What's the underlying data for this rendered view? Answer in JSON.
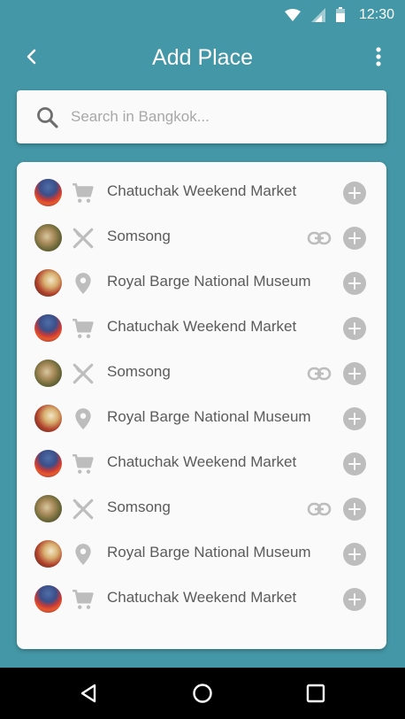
{
  "status_bar": {
    "time": "12:30"
  },
  "app_bar": {
    "title": "Add Place"
  },
  "search": {
    "placeholder": "Search in Bangkok..."
  },
  "places": [
    {
      "name": "Chatuchak Weekend Market",
      "category": "shopping-cart-icon",
      "image": "market",
      "linked": false
    },
    {
      "name": "Somsong",
      "category": "restaurant-icon",
      "image": "food",
      "linked": true
    },
    {
      "name": "Royal Barge National Museum",
      "category": "place-marker-icon",
      "image": "museum",
      "linked": false
    },
    {
      "name": "Chatuchak Weekend Market",
      "category": "shopping-cart-icon",
      "image": "market",
      "linked": false
    },
    {
      "name": "Somsong",
      "category": "restaurant-icon",
      "image": "food",
      "linked": true
    },
    {
      "name": "Royal Barge National Museum",
      "category": "place-marker-icon",
      "image": "museum",
      "linked": false
    },
    {
      "name": "Chatuchak Weekend Market",
      "category": "shopping-cart-icon",
      "image": "market",
      "linked": false
    },
    {
      "name": "Somsong",
      "category": "restaurant-icon",
      "image": "food",
      "linked": true
    },
    {
      "name": "Royal Barge National Museum",
      "category": "place-marker-icon",
      "image": "museum",
      "linked": false
    },
    {
      "name": "Chatuchak Weekend Market",
      "category": "shopping-cart-icon",
      "image": "market",
      "linked": false
    }
  ],
  "colors": {
    "background": "#4497a6",
    "card": "#fafafa",
    "icon_grey": "#bdbdbd",
    "text": "#5b5b5b"
  }
}
